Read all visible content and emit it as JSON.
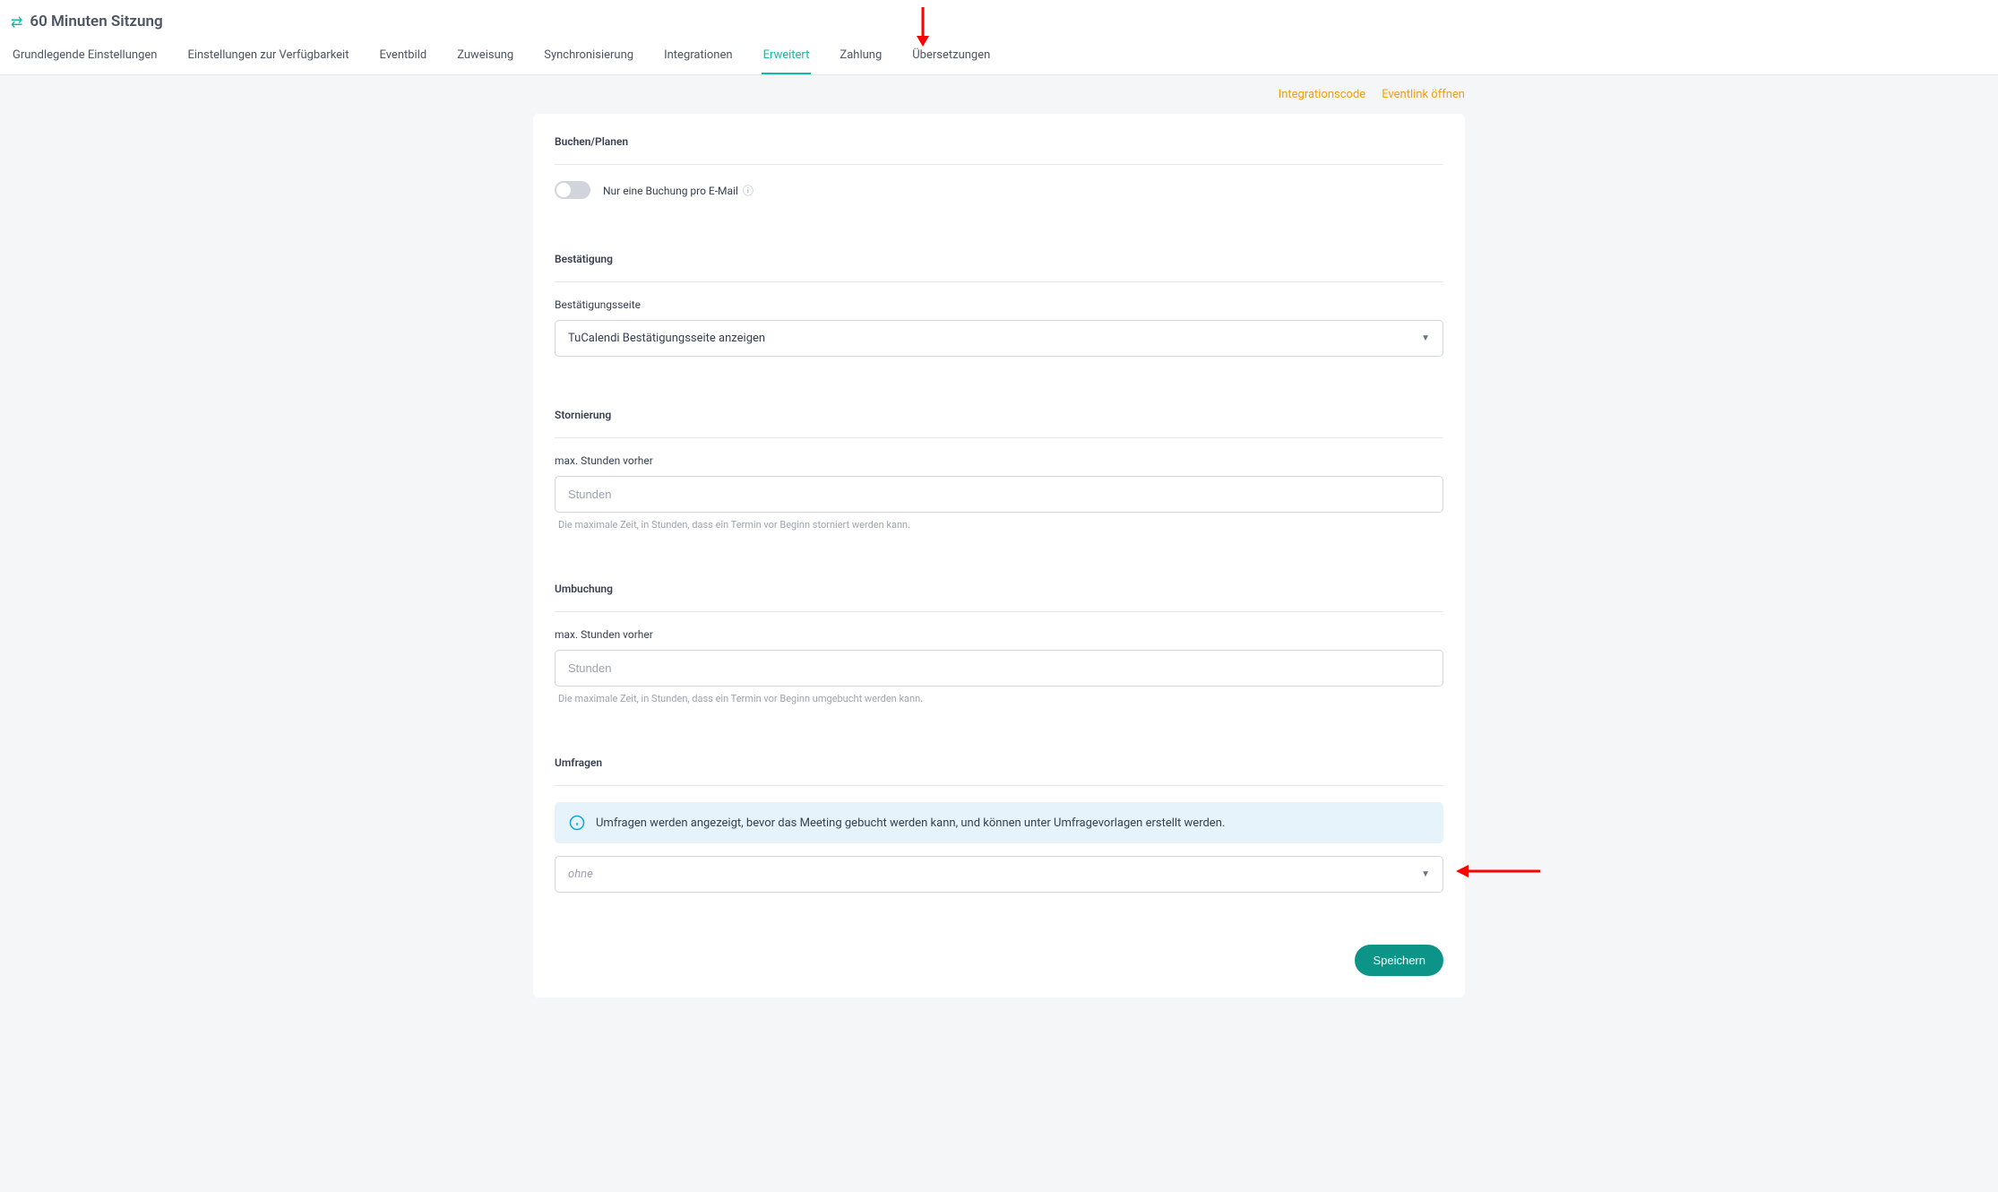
{
  "header": {
    "title": "60 Minuten Sitzung"
  },
  "tabs": [
    {
      "label": "Grundlegende Einstellungen",
      "active": false
    },
    {
      "label": "Einstellungen zur Verfügbarkeit",
      "active": false
    },
    {
      "label": "Eventbild",
      "active": false
    },
    {
      "label": "Zuweisung",
      "active": false
    },
    {
      "label": "Synchronisierung",
      "active": false
    },
    {
      "label": "Integrationen",
      "active": false
    },
    {
      "label": "Erweitert",
      "active": true
    },
    {
      "label": "Zahlung",
      "active": false
    },
    {
      "label": "Übersetzungen",
      "active": false
    }
  ],
  "actions": {
    "integration_code": "Integrationscode",
    "open_event_link": "Eventlink öffnen"
  },
  "sections": {
    "booking": {
      "heading": "Buchen/Planen",
      "toggle_label": "Nur eine Buchung pro E-Mail"
    },
    "confirmation": {
      "heading": "Bestätigung",
      "page_label": "Bestätigungsseite",
      "selected": "TuCalendi Bestätigungsseite anzeigen"
    },
    "cancellation": {
      "heading": "Stornierung",
      "hours_label": "max. Stunden vorher",
      "placeholder": "Stunden",
      "hint": "Die maximale Zeit, in Stunden, dass ein Termin vor Beginn storniert werden kann."
    },
    "reschedule": {
      "heading": "Umbuchung",
      "hours_label": "max. Stunden vorher",
      "placeholder": "Stunden",
      "hint": "Die maximale Zeit, in Stunden, dass ein Termin vor Beginn umgebucht werden kann."
    },
    "surveys": {
      "heading": "Umfragen",
      "info": "Umfragen werden angezeigt, bevor das Meeting gebucht werden kann, und können unter Umfragevorlagen erstellt werden.",
      "placeholder": "ohne"
    }
  },
  "buttons": {
    "save": "Speichern"
  }
}
